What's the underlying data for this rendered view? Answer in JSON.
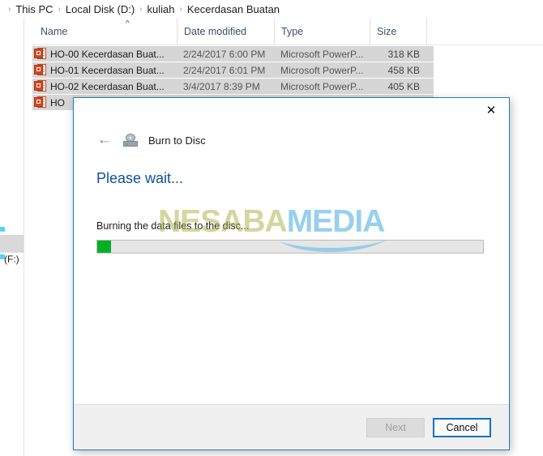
{
  "explorer": {
    "breadcrumb": {
      "separator": "›",
      "items": [
        "This PC",
        "Local Disk (D:)",
        "kuliah",
        "Kecerdasan Buatan"
      ]
    },
    "nav_pane": {
      "visible_label": "(F:)"
    },
    "columns": [
      {
        "label": "Name",
        "sort_indicator": "^"
      },
      {
        "label": "Date modified",
        "sort_indicator": ""
      },
      {
        "label": "Type",
        "sort_indicator": ""
      },
      {
        "label": "Size",
        "sort_indicator": ""
      }
    ],
    "files": [
      {
        "icon": "powerpoint-file-icon",
        "name": "HO-00 Kecerdasan Buat...",
        "date_modified": "2/24/2017 6:00 PM",
        "type": "Microsoft PowerP...",
        "size": "318 KB"
      },
      {
        "icon": "powerpoint-file-icon",
        "name": "HO-01 Kecerdasan Buat...",
        "date_modified": "2/24/2017 6:01 PM",
        "type": "Microsoft PowerP...",
        "size": "458 KB"
      },
      {
        "icon": "powerpoint-file-icon",
        "name": "HO-02 Kecerdasan Buat...",
        "date_modified": "3/4/2017 8:39 PM",
        "type": "Microsoft PowerP...",
        "size": "405 KB"
      },
      {
        "icon": "powerpoint-file-icon",
        "name": "HO",
        "date_modified": "",
        "type": "",
        "size": ""
      }
    ]
  },
  "dialog": {
    "close_label": "✕",
    "back_label": "←",
    "icon": "burn-disc-icon",
    "title": "Burn to Disc",
    "heading": "Please wait...",
    "status_text": "Burning the data files to the disc...",
    "progress": {
      "percent": 3.6,
      "fill_color": "#06b025",
      "track_color": "#e6e6e6"
    },
    "buttons": {
      "next": {
        "label": "Next",
        "enabled": false
      },
      "cancel": {
        "label": "Cancel",
        "enabled": true,
        "focused": true
      }
    },
    "accent_color": "#1a7bc4",
    "heading_color": "#12509e"
  },
  "watermark": {
    "part_a": "NESABA",
    "part_b": "MEDIA",
    "color_a": "#a4b040",
    "color_b": "#7ec3e8"
  }
}
